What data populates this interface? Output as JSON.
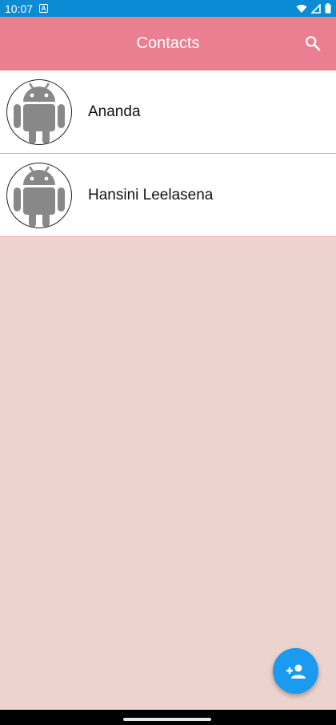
{
  "status_bar": {
    "time": "10:07",
    "notification_glyph": "A"
  },
  "app_bar": {
    "title": "Contacts",
    "search_icon": "search-icon"
  },
  "contacts": [
    {
      "name": "Ananda",
      "avatar": "android-robot-icon"
    },
    {
      "name": "Hansini Leelasena",
      "avatar": "android-robot-icon"
    }
  ],
  "fab": {
    "icon": "person-add-icon"
  },
  "colors": {
    "status_bar": "#0b8bd4",
    "app_bar": "#ea7f92",
    "background": "#ecd3cd",
    "fab": "#1a9bf0",
    "row_divider": "#e8a9ad"
  }
}
